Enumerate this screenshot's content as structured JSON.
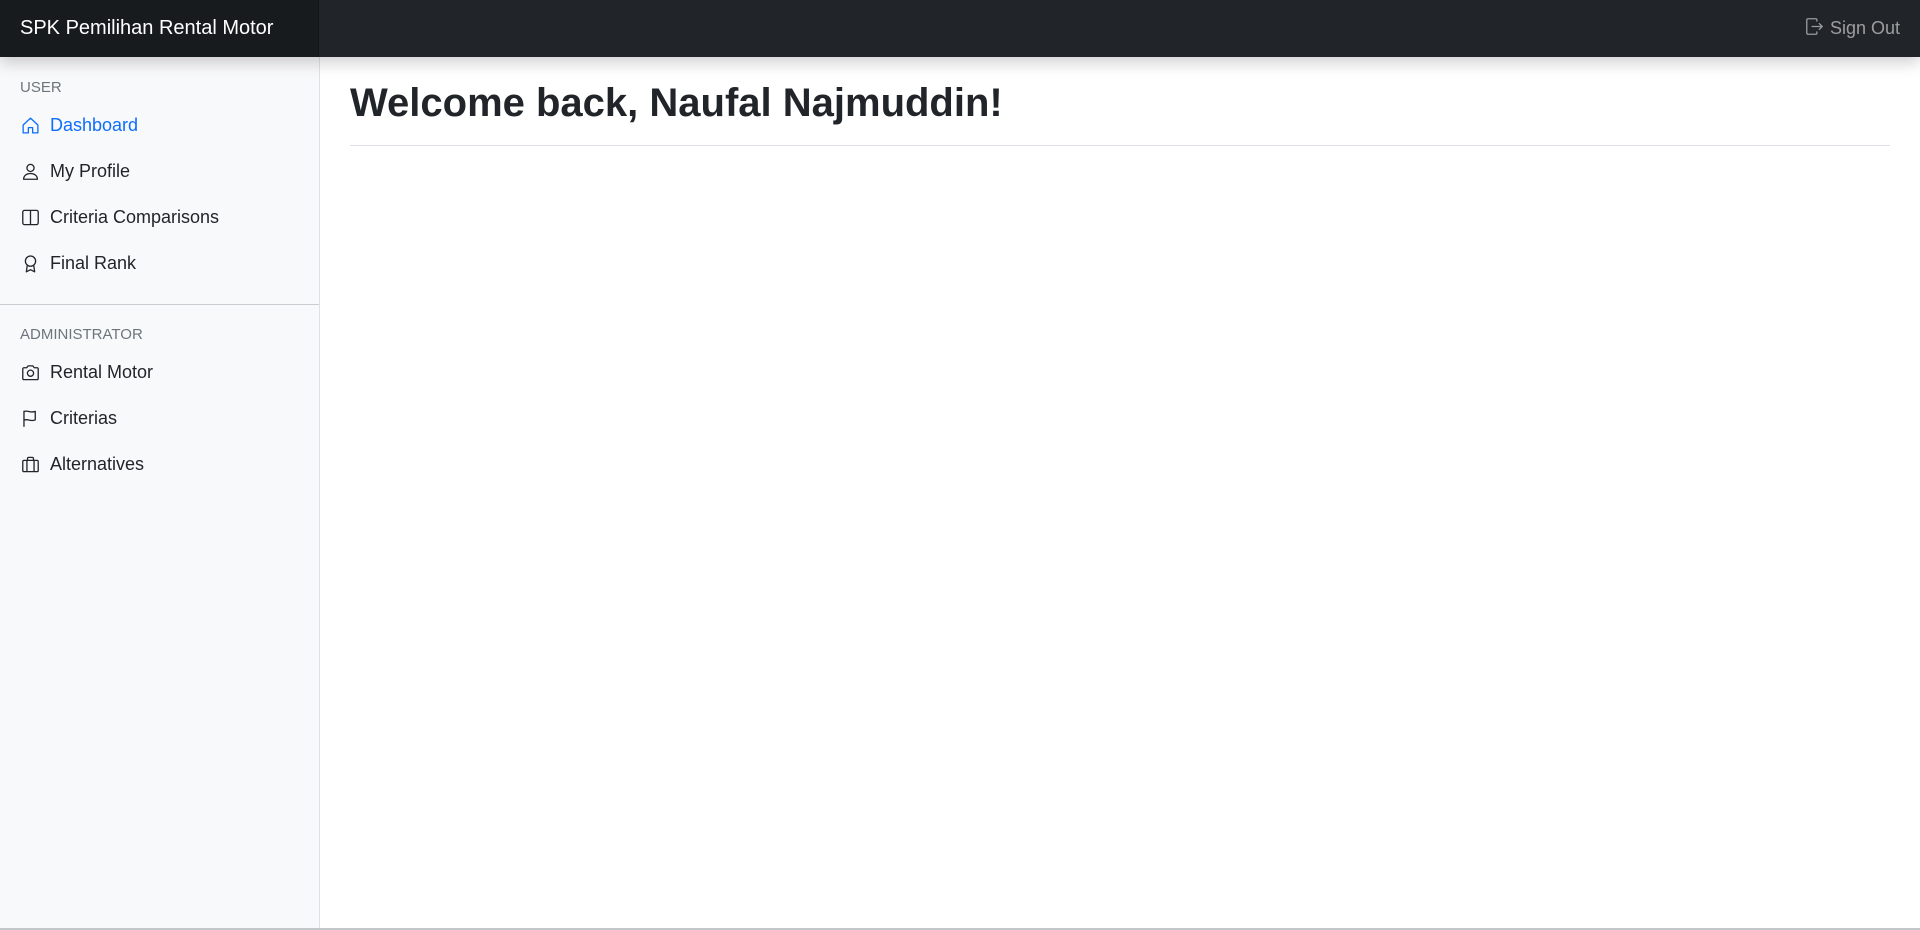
{
  "navbar": {
    "brand": "SPK Pemilihan Rental Motor",
    "signout_label": "Sign Out",
    "signout_icon": "box-arrow-right-icon"
  },
  "sidebar": {
    "user_heading": "USER",
    "user_items": [
      {
        "label": "Dashboard",
        "icon": "house-icon",
        "active": true
      },
      {
        "label": "My Profile",
        "icon": "person-icon",
        "active": false
      },
      {
        "label": "Criteria Comparisons",
        "icon": "layout-split-icon",
        "active": false
      },
      {
        "label": "Final Rank",
        "icon": "award-icon",
        "active": false
      }
    ],
    "admin_heading": "ADMINISTRATOR",
    "admin_items": [
      {
        "label": "Rental Motor",
        "icon": "camera-icon",
        "active": false
      },
      {
        "label": "Criterias",
        "icon": "flag-icon",
        "active": false
      },
      {
        "label": "Alternatives",
        "icon": "briefcase-icon",
        "active": false
      }
    ]
  },
  "main": {
    "title": "Welcome back, Naufal Najmuddin!"
  },
  "colors": {
    "navbar_bg": "#212529",
    "sidebar_bg": "#f8f9fa",
    "active_link": "#0d6efd",
    "heading_text": "#212529"
  }
}
